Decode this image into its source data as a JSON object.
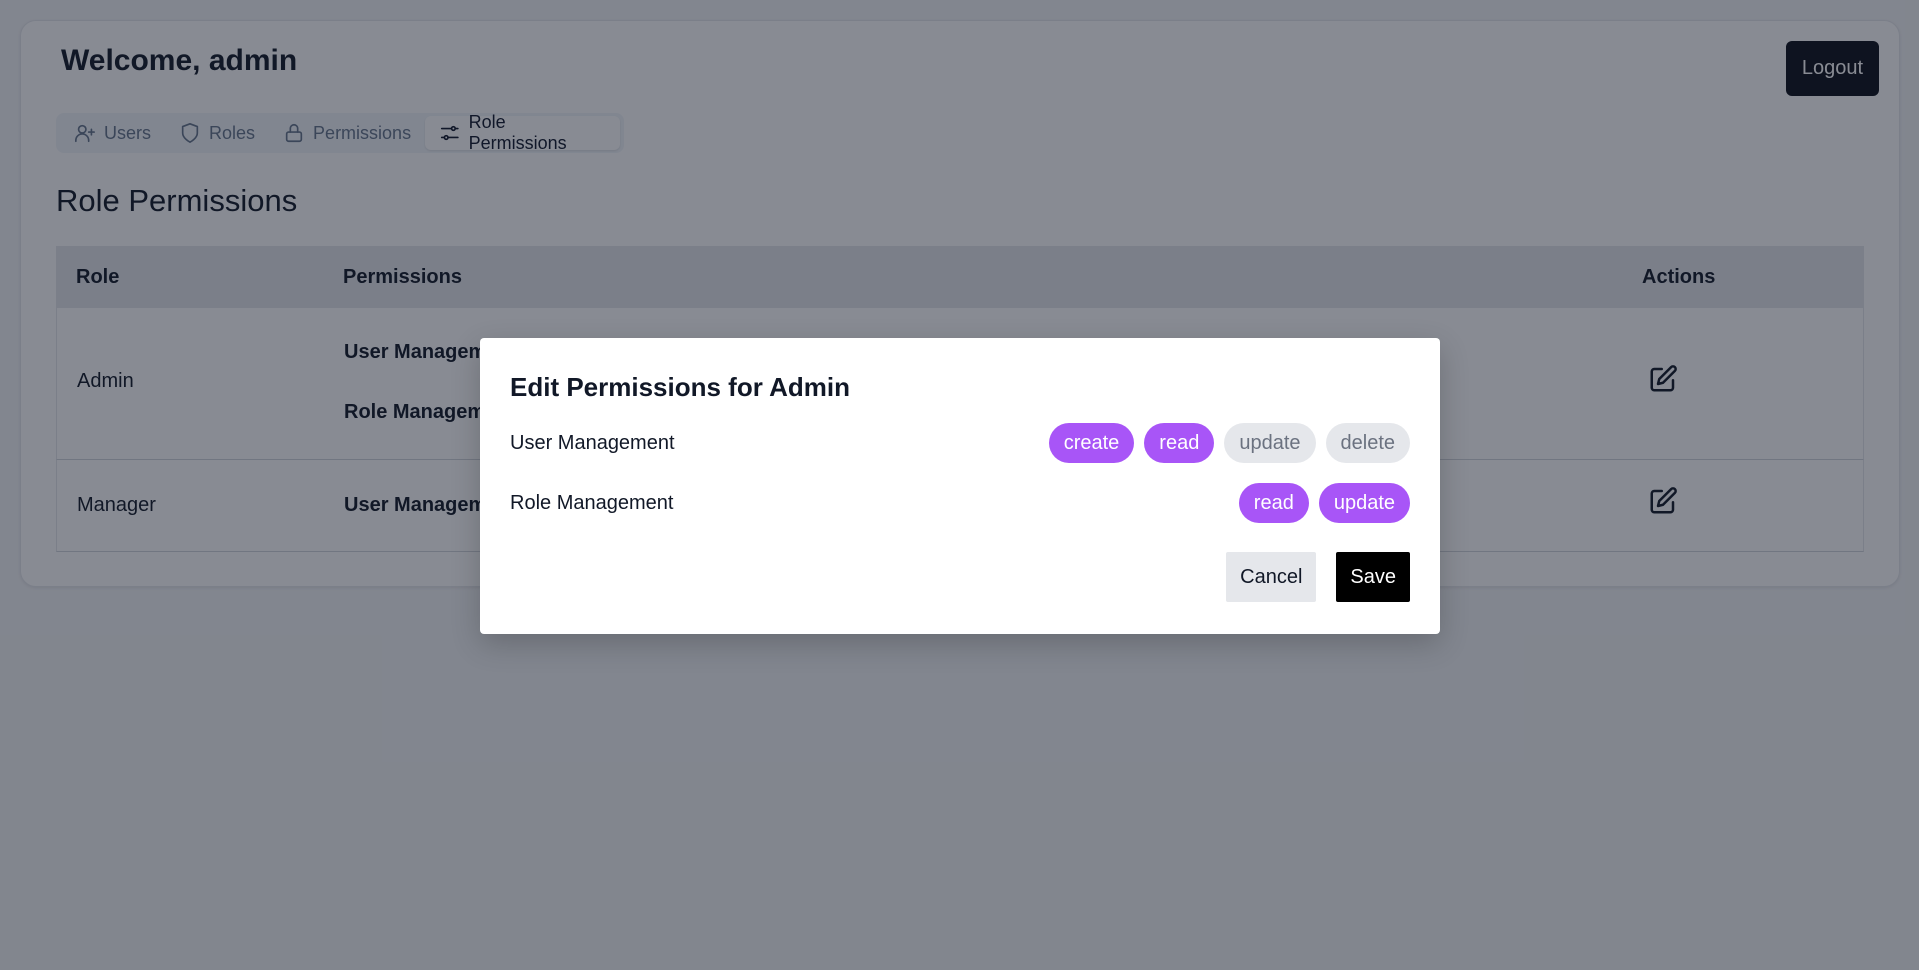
{
  "header": {
    "welcome": "Welcome, admin",
    "logout_label": "Logout"
  },
  "tabs": [
    {
      "label": "Users",
      "icon": "user-plus-icon"
    },
    {
      "label": "Roles",
      "icon": "shield-icon"
    },
    {
      "label": "Permissions",
      "icon": "lock-icon"
    },
    {
      "label": "Role Permissions",
      "icon": "sliders-icon",
      "active": true
    }
  ],
  "main": {
    "title": "Role Permissions",
    "table": {
      "headers": {
        "role": "Role",
        "permissions": "Permissions",
        "actions": "Actions"
      },
      "rows": [
        {
          "role": "Admin",
          "groups": [
            "User Managem",
            "Role Managem"
          ]
        },
        {
          "role": "Manager",
          "groups": [
            "User Managem"
          ]
        }
      ]
    }
  },
  "modal": {
    "title": "Edit Permissions for Admin",
    "groups": [
      {
        "name": "User Management",
        "actions": [
          {
            "label": "create",
            "enabled": true
          },
          {
            "label": "read",
            "enabled": true
          },
          {
            "label": "update",
            "enabled": false
          },
          {
            "label": "delete",
            "enabled": false
          }
        ]
      },
      {
        "name": "Role Management",
        "actions": [
          {
            "label": "read",
            "enabled": true
          },
          {
            "label": "update",
            "enabled": true
          }
        ]
      }
    ],
    "cancel_label": "Cancel",
    "save_label": "Save"
  },
  "colors": {
    "chip_enabled": "#a855f7",
    "chip_disabled": "#e5e7eb",
    "overlay": "rgba(17,24,39,0.5)",
    "primary_button": "#000000"
  }
}
